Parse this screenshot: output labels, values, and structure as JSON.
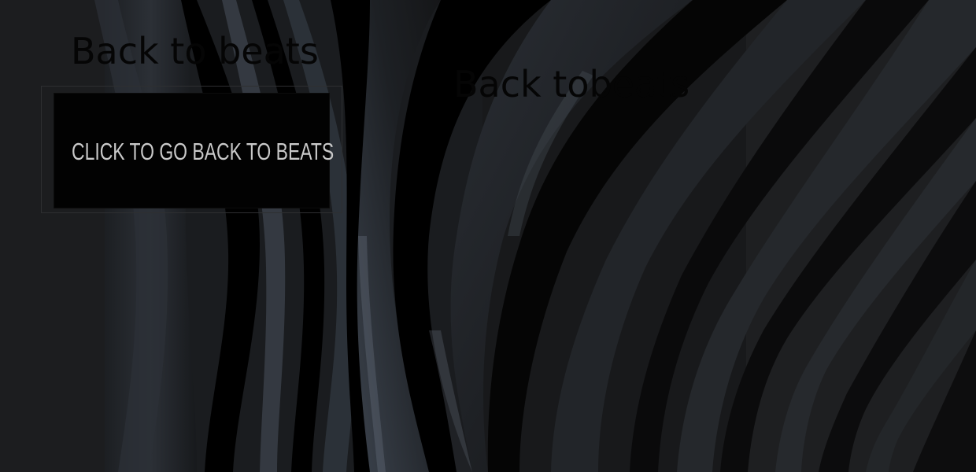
{
  "page": {
    "heading_left": "Back to beats",
    "heading_right": "Back tobeats"
  },
  "back_button": {
    "label": "CLICK TO GO BACK TO BEATS"
  },
  "colors": {
    "background": "#1c1d1f",
    "button_background": "#020202",
    "button_text": "#c9c9c9",
    "heading_text": "#050505"
  }
}
